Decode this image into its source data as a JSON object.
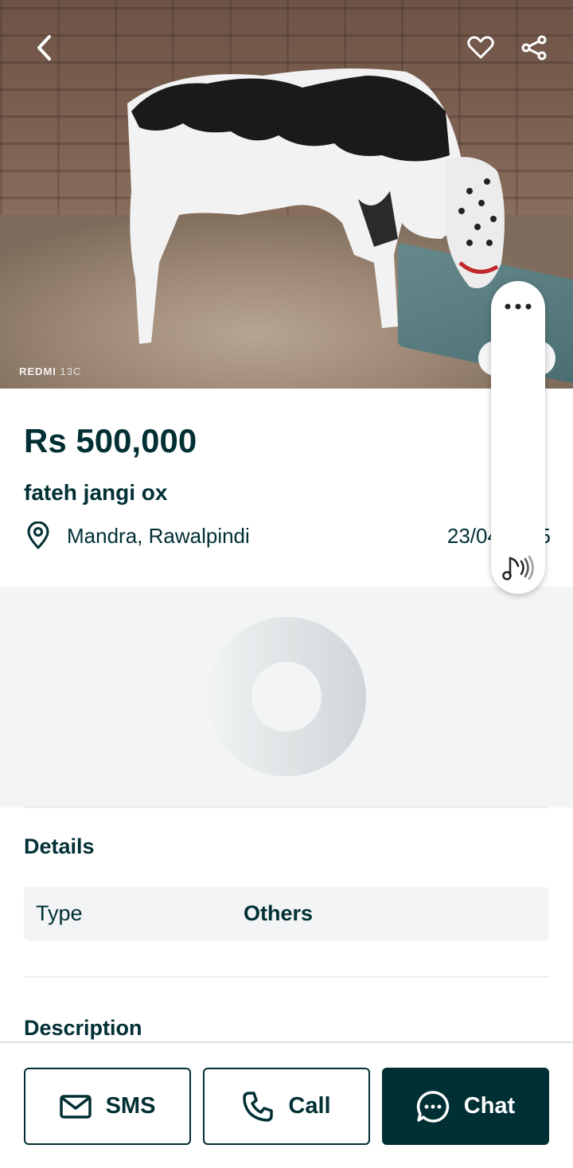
{
  "hero": {
    "watermark_brand": "REDMI",
    "watermark_model": "13C"
  },
  "listing": {
    "price": "Rs 500,000",
    "title": "fateh jangi ox",
    "location": "Mandra, Rawalpindi",
    "date": "23/04/2025"
  },
  "details": {
    "heading": "Details",
    "rows": [
      {
        "key": "Type",
        "value": "Others"
      }
    ]
  },
  "description": {
    "heading": "Description"
  },
  "actions": {
    "sms_label": "SMS",
    "call_label": "Call",
    "chat_label": "Chat"
  },
  "icons": {
    "back": "chevron-left-icon",
    "favorite": "heart-icon",
    "share": "share-icon",
    "location": "location-pin-icon",
    "sms": "mail-icon",
    "call": "phone-icon",
    "chat": "chat-bubble-icon",
    "more": "more-dots-icon",
    "sound": "sound-icon"
  },
  "colors": {
    "primary": "#002f34",
    "surface": "#f2f4f5",
    "on_primary": "#ffffff"
  }
}
